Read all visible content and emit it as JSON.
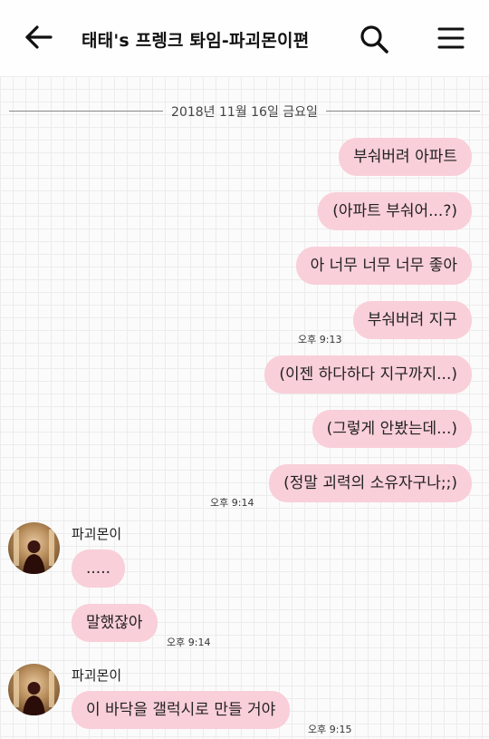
{
  "header": {
    "title": "태태's 프렝크 톼임-파괴몬이편",
    "back_icon": "arrow-left-icon",
    "search_icon": "search-icon",
    "menu_icon": "hamburger-menu-icon"
  },
  "date_divider": "2018년 11월 16일 금요일",
  "colors": {
    "bubble": "#f9cfd9",
    "background": "#fbfbfb"
  },
  "messages": {
    "out1": "부숴버려 아파트",
    "out2": "(아파트 부숴어...?)",
    "out3": "아 너무 너무 너무 좋아",
    "out4": "부숴버려 지구",
    "time1": "오후 9:13",
    "out5": "(이젠 하다하다 지구까지...)",
    "out6": "(그렇게 안봤는데...)",
    "out7": "(정말 괴력의 소유자구나;;)",
    "time2": "오후 9:14",
    "sender1": "파괴몬이",
    "in1": ".....",
    "in2": "말했잖아",
    "time3": "오후 9:14",
    "sender2": "파괴몬이",
    "in3": "이 바닥을 갤럭시로 만들 거야",
    "time4": "오후 9:15"
  }
}
